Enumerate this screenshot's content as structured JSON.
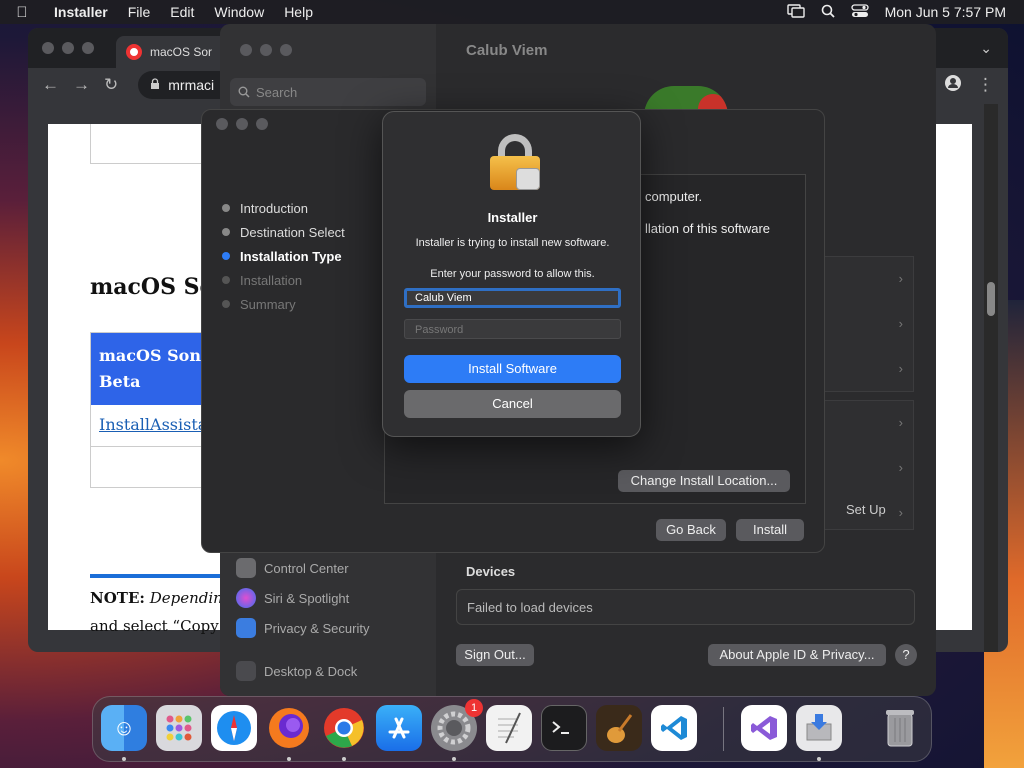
{
  "menubar": {
    "app_name": "Installer",
    "menus": [
      "File",
      "Edit",
      "Window",
      "Help"
    ],
    "clock": "Mon Jun 5  7:57 PM"
  },
  "browser": {
    "tab_title": "macOS Sor",
    "address": "mrmaci",
    "page": {
      "heading": "macOS So",
      "table_header": "macOS Sonor Beta",
      "table_link": "InstallAssista",
      "note_bold": "NOTE:",
      "note_italic": "Dependin",
      "note_rest": "and select “Copy"
    }
  },
  "settings": {
    "search_placeholder": "Search",
    "account_name": "Calub Viem",
    "sidebar": [
      "Control Center",
      "Siri & Spotlight",
      "Privacy & Security",
      "Desktop & Dock"
    ],
    "setup_label": "Set Up",
    "devices_heading": "Devices",
    "devices_status": "Failed to load devices",
    "sign_out": "Sign Out...",
    "about": "About Apple ID & Privacy...",
    "help": "?"
  },
  "installer": {
    "steps": [
      {
        "label": "Introduction",
        "state": "done"
      },
      {
        "label": "Destination Select",
        "state": "done"
      },
      {
        "label": "Installation Type",
        "state": "active"
      },
      {
        "label": "Installation",
        "state": "pending"
      },
      {
        "label": "Summary",
        "state": "pending"
      }
    ],
    "pane_text1": "computer.",
    "pane_text2": "llation of this software",
    "change_location": "Change Install Location...",
    "go_back": "Go Back",
    "install": "Install"
  },
  "dialog": {
    "title": "Installer",
    "message": "Installer is trying to install new software.",
    "prompt": "Enter your password to allow this.",
    "username_value": "Calub Viem",
    "password_placeholder": "Password",
    "install_button": "Install Software",
    "cancel_button": "Cancel"
  },
  "dock": {
    "apps": [
      "finder-icon",
      "launchpad-icon",
      "safari-icon",
      "firefox-icon",
      "chrome-icon",
      "app-store-icon",
      "system-settings-icon",
      "textedit-icon",
      "terminal-icon",
      "garageband-icon",
      "vscode-icon",
      "visual-studio-icon",
      "installer-icon",
      "trash-icon"
    ],
    "settings_badge": "1"
  },
  "colors": {
    "accent": "#2d7cf6",
    "link_blue": "#1a5fb4",
    "table_header": "#2e64e8"
  }
}
